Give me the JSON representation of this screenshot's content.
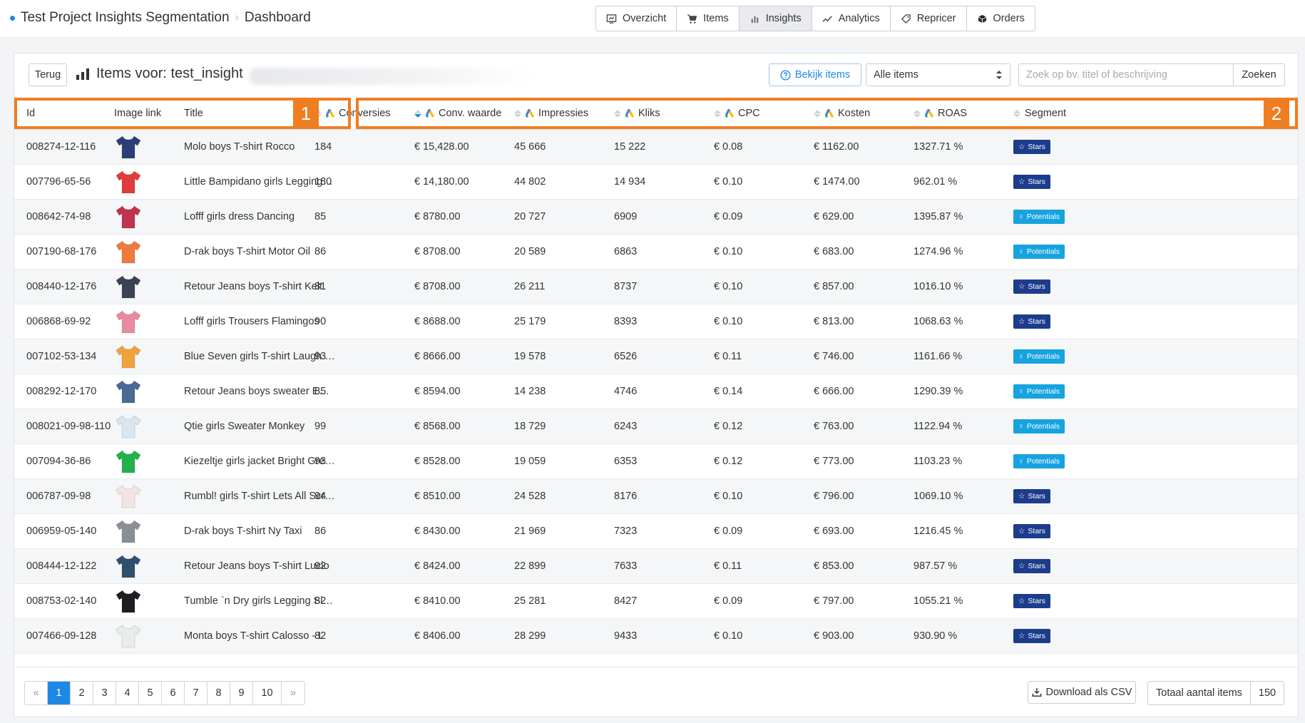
{
  "breadcrumb": {
    "project": "Test Project Insights Segmentation",
    "page": "Dashboard"
  },
  "nav": [
    {
      "label": "Overzicht",
      "icon": "dashboard-icon",
      "active": false
    },
    {
      "label": "Items",
      "icon": "cart-icon",
      "active": false
    },
    {
      "label": "Insights",
      "icon": "bar-chart-icon",
      "active": true
    },
    {
      "label": "Analytics",
      "icon": "trend-line-icon",
      "active": false
    },
    {
      "label": "Repricer",
      "icon": "tag-icon",
      "active": false
    },
    {
      "label": "Orders",
      "icon": "box-icon",
      "active": false
    }
  ],
  "toolbar": {
    "back_label": "Terug",
    "title": "Items voor: test_insight",
    "view_items_label": "Bekijk items",
    "filter_value": "Alle items",
    "search_placeholder": "Zoek op bv. titel of beschrijving",
    "search_button": "Zoeken"
  },
  "table": {
    "headers": {
      "id": "Id",
      "image": "Image link",
      "title": "Title",
      "conversions": "Conversies",
      "conv_value": "Conv. waarde",
      "impressions": "Impressies",
      "clicks": "Kliks",
      "cpc": "CPC",
      "cost": "Kosten",
      "roas": "ROAS",
      "segment": "Segment"
    },
    "rows": [
      {
        "id": "008274-12-116",
        "title": "Molo boys T-shirt Rocco",
        "conversions": "184",
        "conv_value": "€ 15,428.00",
        "impressions": "45 666",
        "clicks": "15 222",
        "cpc": "€ 0.08",
        "cost": "€ 1162.00",
        "roas": "1327.71 %",
        "segment": "Stars",
        "thumb_color": "#2c3e7a"
      },
      {
        "id": "007796-65-56",
        "title": "Little Bampidano girls Legging…",
        "conversions": "180",
        "conv_value": "€ 14,180.00",
        "impressions": "44 802",
        "clicks": "14 934",
        "cpc": "€ 0.10",
        "cost": "€ 1474.00",
        "roas": "962.01 %",
        "segment": "Stars",
        "thumb_color": "#e23b3b"
      },
      {
        "id": "008642-74-98",
        "title": "Lofff girls dress Dancing",
        "conversions": "85",
        "conv_value": "€ 8780.00",
        "impressions": "20 727",
        "clicks": "6909",
        "cpc": "€ 0.09",
        "cost": "€ 629.00",
        "roas": "1395.87 %",
        "segment": "Potentials",
        "thumb_color": "#c2334d"
      },
      {
        "id": "007190-68-176",
        "title": "D-rak boys T-shirt Motor Oil",
        "conversions": "86",
        "conv_value": "€ 8708.00",
        "impressions": "20 589",
        "clicks": "6863",
        "cpc": "€ 0.10",
        "cost": "€ 683.00",
        "roas": "1274.96 %",
        "segment": "Potentials",
        "thumb_color": "#ee7a3c"
      },
      {
        "id": "008440-12-176",
        "title": "Retour Jeans boys T-shirt Kelt",
        "conversions": "81",
        "conv_value": "€ 8708.00",
        "impressions": "26 211",
        "clicks": "8737",
        "cpc": "€ 0.10",
        "cost": "€ 857.00",
        "roas": "1016.10 %",
        "segment": "Stars",
        "thumb_color": "#3a4256"
      },
      {
        "id": "006868-69-92",
        "title": "Lofff girls Trousers Flamingos",
        "conversions": "90",
        "conv_value": "€ 8688.00",
        "impressions": "25 179",
        "clicks": "8393",
        "cpc": "€ 0.10",
        "cost": "€ 813.00",
        "roas": "1068.63 %",
        "segment": "Stars",
        "thumb_color": "#e98aa2"
      },
      {
        "id": "007102-53-134",
        "title": "Blue Seven girls T-shirt Laugh …",
        "conversions": "93",
        "conv_value": "€ 8666.00",
        "impressions": "19 578",
        "clicks": "6526",
        "cpc": "€ 0.11",
        "cost": "€ 746.00",
        "roas": "1161.66 %",
        "segment": "Potentials",
        "thumb_color": "#f2a23c"
      },
      {
        "id": "008292-12-170",
        "title": "Retour Jeans boys sweater E…",
        "conversions": "85",
        "conv_value": "€ 8594.00",
        "impressions": "14 238",
        "clicks": "4746",
        "cpc": "€ 0.14",
        "cost": "€ 666.00",
        "roas": "1290.39 %",
        "segment": "Potentials",
        "thumb_color": "#4a6a94"
      },
      {
        "id": "008021-09-98-110",
        "title": "Qtie girls Sweater Monkey",
        "conversions": "99",
        "conv_value": "€ 8568.00",
        "impressions": "18 729",
        "clicks": "6243",
        "cpc": "€ 0.12",
        "cost": "€ 763.00",
        "roas": "1122.94 %",
        "segment": "Potentials",
        "thumb_color": "#d8e6f2"
      },
      {
        "id": "007094-36-86",
        "title": "Kiezeltje girls jacket Bright Gre…",
        "conversions": "93",
        "conv_value": "€ 8528.00",
        "impressions": "19 059",
        "clicks": "6353",
        "cpc": "€ 0.12",
        "cost": "€ 773.00",
        "roas": "1103.23 %",
        "segment": "Potentials",
        "thumb_color": "#22b14c"
      },
      {
        "id": "006787-09-98",
        "title": "Rumbl! girls T-shirt Lets All Scr…",
        "conversions": "94",
        "conv_value": "€ 8510.00",
        "impressions": "24 528",
        "clicks": "8176",
        "cpc": "€ 0.10",
        "cost": "€ 796.00",
        "roas": "1069.10 %",
        "segment": "Stars",
        "thumb_color": "#f3e4e4"
      },
      {
        "id": "006959-05-140",
        "title": "D-rak boys T-shirt Ny Taxi",
        "conversions": "86",
        "conv_value": "€ 8430.00",
        "impressions": "21 969",
        "clicks": "7323",
        "cpc": "€ 0.09",
        "cost": "€ 693.00",
        "roas": "1216.45 %",
        "segment": "Stars",
        "thumb_color": "#8a8f96"
      },
      {
        "id": "008444-12-122",
        "title": "Retour Jeans boys T-shirt Lucio",
        "conversions": "92",
        "conv_value": "€ 8424.00",
        "impressions": "22 899",
        "clicks": "7633",
        "cpc": "€ 0.11",
        "cost": "€ 853.00",
        "roas": "987.57 %",
        "segment": "Stars",
        "thumb_color": "#2f4f6f"
      },
      {
        "id": "008753-02-140",
        "title": "Tumble `n Dry girls Legging Si…",
        "conversions": "82",
        "conv_value": "€ 8410.00",
        "impressions": "25 281",
        "clicks": "8427",
        "cpc": "€ 0.09",
        "cost": "€ 797.00",
        "roas": "1055.21 %",
        "segment": "Stars",
        "thumb_color": "#1d1d22"
      },
      {
        "id": "007466-09-128",
        "title": "Monta boys T-shirt Calosso - L",
        "conversions": "82",
        "conv_value": "€ 8406.00",
        "impressions": "28 299",
        "clicks": "9433",
        "cpc": "€ 0.10",
        "cost": "€ 903.00",
        "roas": "930.90 %",
        "segment": "Stars",
        "thumb_color": "#e9ecea"
      }
    ]
  },
  "annotations": {
    "box1": "1",
    "box2": "2"
  },
  "pagination": {
    "prev": "«",
    "pages": [
      "1",
      "2",
      "3",
      "4",
      "5",
      "6",
      "7",
      "8",
      "9",
      "10"
    ],
    "active": "1",
    "next": "»"
  },
  "footer": {
    "csv_label": "Download als CSV",
    "total_label": "Totaal aantal items",
    "total_value": "150"
  },
  "colors": {
    "accent": "#1e88e5",
    "stars": "#1c3c8c",
    "potentials": "#16a3e0",
    "annotation": "#ef7d22"
  }
}
